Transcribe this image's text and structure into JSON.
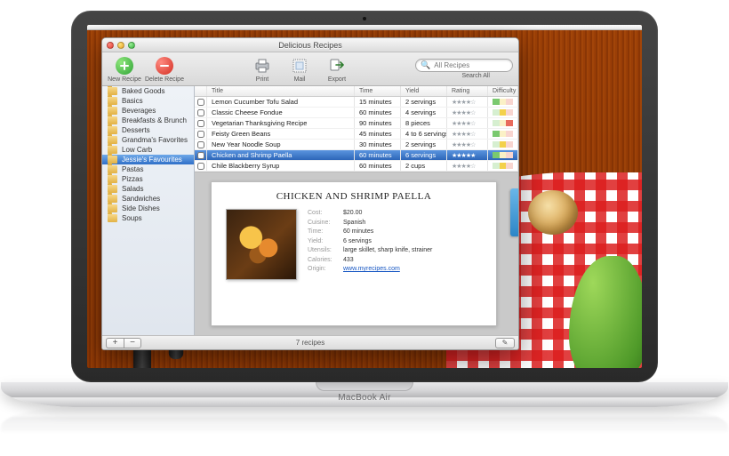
{
  "device_label": "MacBook Air",
  "window": {
    "title": "Delicious Recipes"
  },
  "toolbar": {
    "new_recipe": "New Recipe",
    "delete_recipe": "Delete Recipe",
    "print": "Print",
    "mail": "Mail",
    "export": "Export",
    "search_placeholder": "All Recipes",
    "search_label": "Search All"
  },
  "sidebar": {
    "items": [
      {
        "label": "Baked Goods"
      },
      {
        "label": "Basics"
      },
      {
        "label": "Beverages"
      },
      {
        "label": "Breakfasts & Brunch"
      },
      {
        "label": "Desserts"
      },
      {
        "label": "Grandma's Favorites"
      },
      {
        "label": "Low Carb"
      },
      {
        "label": "Jessie's Favourites",
        "selected": true
      },
      {
        "label": "Pastas"
      },
      {
        "label": "Pizzas"
      },
      {
        "label": "Salads"
      },
      {
        "label": "Sandwiches"
      },
      {
        "label": "Side Dishes"
      },
      {
        "label": "Soups"
      }
    ]
  },
  "table": {
    "columns": {
      "title": "Title",
      "time": "Time",
      "yield": "Yield",
      "rating": "Rating",
      "difficulty": "Difficulty"
    },
    "rows": [
      {
        "title": "Lemon Cucumber Tofu Salad",
        "time": "15 minutes",
        "yield": "2 servings",
        "rating": 4,
        "difficulty": "easy"
      },
      {
        "title": "Classic Cheese Fondue",
        "time": "60 minutes",
        "yield": "4 servings",
        "rating": 4,
        "difficulty": "medium"
      },
      {
        "title": "Vegetarian Thanksgiving Recipe",
        "time": "90 minutes",
        "yield": "8 pieces",
        "rating": 4,
        "difficulty": "hard"
      },
      {
        "title": "Feisty Green Beans",
        "time": "45 minutes",
        "yield": "4 to 6 servings",
        "rating": 4,
        "difficulty": "easy"
      },
      {
        "title": "New Year Noodle Soup",
        "time": "30 minutes",
        "yield": "2 servings",
        "rating": 4,
        "difficulty": "medium"
      },
      {
        "title": "Chicken and Shrimp Paella",
        "time": "60 minutes",
        "yield": "6 servings",
        "rating": 5,
        "difficulty": "easy",
        "selected": true
      },
      {
        "title": "Chile Blackberry Syrup",
        "time": "60 minutes",
        "yield": "2 cups",
        "rating": 4,
        "difficulty": "medium"
      }
    ]
  },
  "detail": {
    "title": "CHICKEN AND SHRIMP PAELLA",
    "meta": {
      "cost_label": "Cost:",
      "cost": "$20.00",
      "cuisine_label": "Cuisine:",
      "cuisine": "Spanish",
      "time_label": "Time:",
      "time": "60 minutes",
      "yield_label": "Yield:",
      "yield": "6 servings",
      "utensils_label": "Utensils:",
      "utensils": "large skillet, sharp knife, strainer",
      "calories_label": "Calories:",
      "calories": "433",
      "origin_label": "Origin:",
      "origin": "www.myrecipes.com"
    }
  },
  "footer": {
    "add": "+",
    "remove": "−",
    "count": "7 recipes"
  }
}
